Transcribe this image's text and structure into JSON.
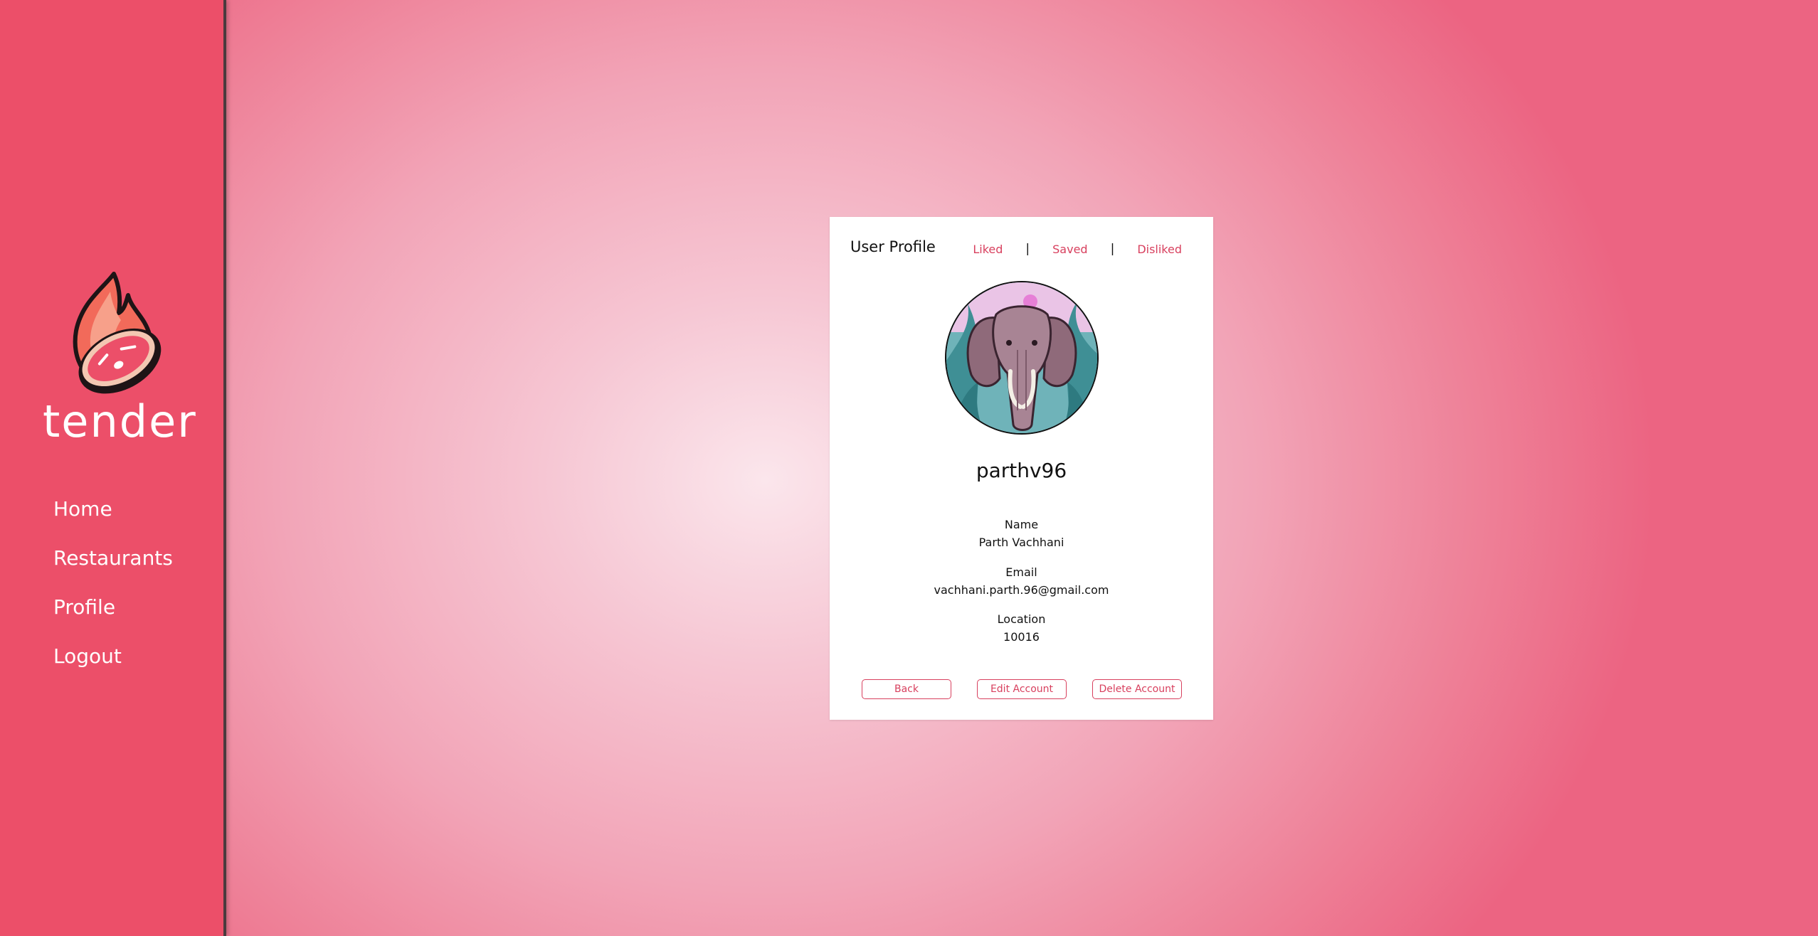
{
  "app": {
    "name": "tender",
    "brand_color": "#ec4f69",
    "accent_color": "#d8405e"
  },
  "sidebar": {
    "logo_icon": "flame-steak-logo",
    "items": [
      {
        "label": "Home"
      },
      {
        "label": "Restaurants"
      },
      {
        "label": "Profile"
      },
      {
        "label": "Logout"
      }
    ]
  },
  "profile": {
    "title": "User Profile",
    "tabs": [
      {
        "label": "Liked"
      },
      {
        "label": "Saved"
      },
      {
        "label": "Disliked"
      }
    ],
    "tab_separator": "|",
    "avatar_icon": "elephant-avatar",
    "username": "parthv96",
    "fields": [
      {
        "label": "Name",
        "value": "Parth Vachhani"
      },
      {
        "label": "Email",
        "value": "vachhani.parth.96@gmail.com"
      },
      {
        "label": "Location",
        "value": "10016"
      }
    ],
    "buttons": {
      "back": "Back",
      "edit": "Edit Account",
      "delete": "Delete Account"
    }
  }
}
